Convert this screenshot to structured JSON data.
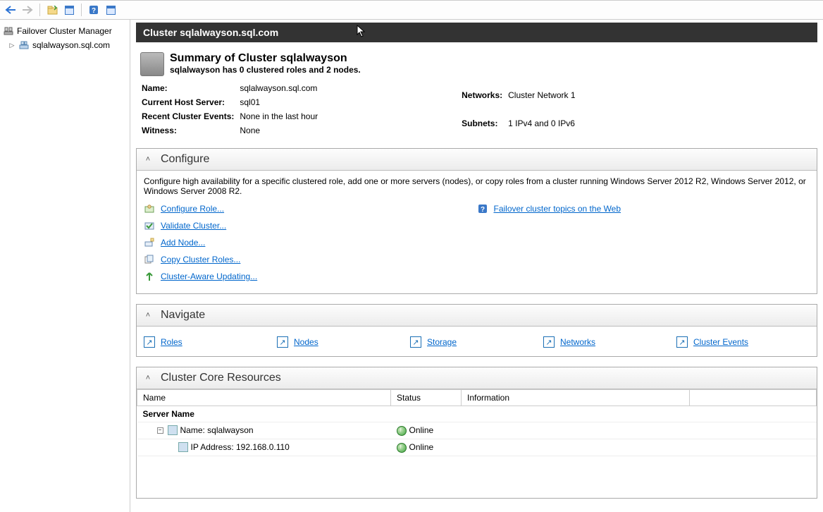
{
  "toolbar": {
    "back": "back",
    "forward": "forward",
    "btn1": "show-hide-console-tree",
    "btn2": "properties",
    "btn3": "help",
    "btn4": "refresh"
  },
  "tree": {
    "root": "Failover Cluster Manager",
    "child": "sqlalwayson.sql.com"
  },
  "header": {
    "title": "Cluster sqlalwayson.sql.com"
  },
  "summary": {
    "title": "Summary of Cluster sqlalwayson",
    "sub": "sqlalwayson has 0 clustered roles and 2 nodes.",
    "left": {
      "name_label": "Name:",
      "name_val": "sqlalwayson.sql.com",
      "host_label": "Current Host Server:",
      "host_val": "sql01",
      "events_label": "Recent Cluster Events:",
      "events_val": "None in the last hour",
      "witness_label": "Witness:",
      "witness_val": "None"
    },
    "right": {
      "networks_label": "Networks:",
      "networks_val": "Cluster Network 1",
      "subnets_label": "Subnets:",
      "subnets_val": "1 IPv4 and 0 IPv6"
    }
  },
  "configure": {
    "title": "Configure",
    "desc": "Configure high availability for a specific clustered role, add one or more servers (nodes), or copy roles from a cluster running Windows Server 2012 R2, Windows Server 2012, or Windows Server 2008 R2.",
    "links": {
      "role": "Configure Role...",
      "validate": "Validate Cluster...",
      "addnode": "Add Node...",
      "copy": "Copy Cluster Roles...",
      "cau": "Cluster-Aware Updating...",
      "web": "Failover cluster topics on the Web"
    }
  },
  "navigate": {
    "title": "Navigate",
    "items": [
      "Roles",
      "Nodes",
      "Storage",
      "Networks",
      "Cluster Events"
    ]
  },
  "core": {
    "title": "Cluster Core Resources",
    "cols": {
      "name": "Name",
      "status": "Status",
      "info": "Information"
    },
    "group": "Server Name",
    "rows": [
      {
        "name": "Name: sqlalwayson",
        "status": "Online"
      },
      {
        "name": "IP Address: 192.168.0.110",
        "status": "Online"
      }
    ]
  }
}
